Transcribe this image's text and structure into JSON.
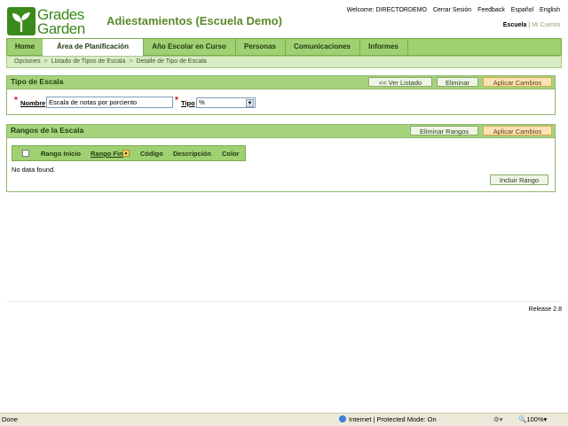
{
  "header": {
    "logo_line1": "Grades",
    "logo_line2": "Garden",
    "app_title": "Adiestamientos (Escuela Demo)",
    "welcome": "Welcome: DIRECTORDEMO",
    "logout": "Cerrar Sesión",
    "feedback": "Feedback",
    "lang_es": "Español",
    "lang_en": "English",
    "scope_school": "Escuela",
    "scope_sep": "|",
    "scope_account": "Mi Cuenta"
  },
  "nav": {
    "items": [
      "Home",
      "Área de Planificación",
      "Año Escolar en Curso",
      "Personas",
      "Comunicaciones",
      "Informes"
    ],
    "active_index": 1
  },
  "breadcrumb": {
    "items": [
      "Opciones",
      "Listado de Tipos de Escala",
      "Detalle de Tipo de Escala"
    ],
    "separator": ">"
  },
  "tipo_panel": {
    "title": "Tipo de Escala",
    "btn_list": "<< Ver Listado",
    "btn_delete": "Eliminar",
    "btn_apply": "Aplicar Cambios",
    "required_mark": "*",
    "name_label": "Nombre",
    "name_value": "Escala de notas por porciento",
    "type_label": "Tipo",
    "type_value": "%"
  },
  "rangos_panel": {
    "title": "Rangos de la Escala",
    "btn_delete": "Eliminar Rangos",
    "btn_apply": "Aplicar Cambios",
    "columns": [
      "Rango Inicio",
      "Rango Fin",
      "Código",
      "Descripción",
      "Color"
    ],
    "no_data": "No data found.",
    "btn_add": "Incluir Rango"
  },
  "footer": {
    "release": "Release 2.8"
  },
  "statusbar": {
    "left": "Done",
    "zone": "Internet | Protected Mode: On",
    "zoom": "100%"
  },
  "colors": {
    "brand_green": "#3a8a1c",
    "nav_green": "#9fd072",
    "button_orange": "#fbe3b6"
  }
}
